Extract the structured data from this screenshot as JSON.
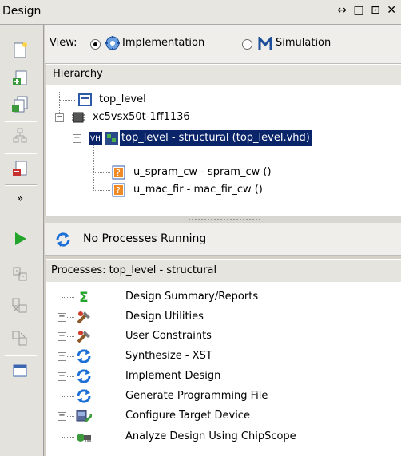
{
  "panel": {
    "title": "Design",
    "controls": "↔ □ ⊡ ✕"
  },
  "view": {
    "label": "View:",
    "options": [
      {
        "label": "Implementation",
        "selected": true,
        "icon": "implementation-icon"
      },
      {
        "label": "Simulation",
        "selected": false,
        "icon": "simulation-icon"
      }
    ]
  },
  "hierarchy": {
    "header": "Hierarchy",
    "items": [
      {
        "label": "top_level",
        "icon": "project-file-icon"
      },
      {
        "label": "xc5vsx50t-1ff1136",
        "icon": "chip-icon"
      },
      {
        "label": "top_level - structural (top_level.vhd)",
        "icon": "vhdl-module-icon",
        "selected": true
      },
      {
        "label": "u_spram_cw - spram_cw ()",
        "icon": "missing-module-icon"
      },
      {
        "label": "u_mac_fir - mac_fir_cw ()",
        "icon": "missing-module-icon"
      }
    ]
  },
  "status": {
    "text": "No Processes Running"
  },
  "processes": {
    "header": "Processes: top_level - structural",
    "items": [
      {
        "label": "Design Summary/Reports",
        "icon": "sigma-icon",
        "expandable": false
      },
      {
        "label": "Design Utilities",
        "icon": "tools-icon",
        "expandable": true
      },
      {
        "label": "User Constraints",
        "icon": "tools-icon",
        "expandable": true
      },
      {
        "label": "Synthesize - XST",
        "icon": "process-run-icon",
        "expandable": true
      },
      {
        "label": "Implement Design",
        "icon": "process-run-icon",
        "expandable": true
      },
      {
        "label": "Generate Programming File",
        "icon": "process-run-icon",
        "expandable": false
      },
      {
        "label": "Configure Target Device",
        "icon": "configure-device-icon",
        "expandable": true
      },
      {
        "label": "Analyze Design Using ChipScope",
        "icon": "chipscope-icon",
        "expandable": false
      }
    ]
  },
  "colors": {
    "selection": "#0a246a",
    "run_green": "#22a52a",
    "process_blue": "#1b6fd6",
    "missing_orange": "#f08a24"
  }
}
